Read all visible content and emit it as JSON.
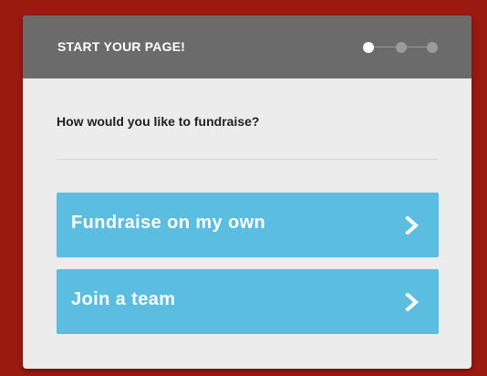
{
  "header": {
    "title": "START YOUR PAGE!",
    "steps_total": 3,
    "current_step": 1
  },
  "prompt": {
    "question": "How would you like to fundraise?"
  },
  "options": [
    {
      "label": "Fundraise on my own",
      "icon": "chevron-right-icon"
    },
    {
      "label": "Join a team",
      "icon": "chevron-right-icon"
    }
  ],
  "colors": {
    "background": "#9a1a10",
    "card": "#ececec",
    "header": "#6b6b6b",
    "option": "#5bbde0",
    "active_step": "#ffffff",
    "inactive_step": "#9b9b9b"
  }
}
